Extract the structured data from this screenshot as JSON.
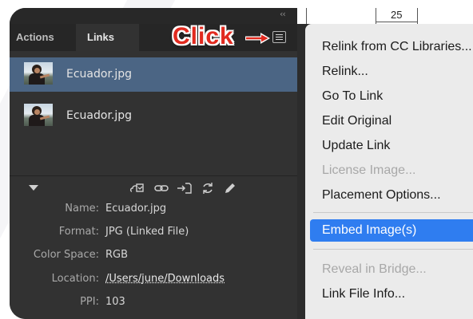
{
  "panel": {
    "tabs": [
      {
        "label": "Actions",
        "active": false
      },
      {
        "label": "Links",
        "active": true
      }
    ],
    "collapse_glyph": "‹‹",
    "links": [
      {
        "name": "Ecuador.jpg",
        "selected": true
      },
      {
        "name": "Ecuador.jpg",
        "selected": false
      }
    ],
    "toolbar_icons": [
      "relink-from-cc-icon",
      "chain-link-icon",
      "go-to-link-icon",
      "update-link-icon",
      "edit-original-icon"
    ],
    "info": [
      {
        "key": "Name:",
        "value": "Ecuador.jpg"
      },
      {
        "key": "Format:",
        "value": "JPG (Linked File)"
      },
      {
        "key": "Color Space:",
        "value": "RGB"
      },
      {
        "key": "Location:",
        "value": "/Users/june/Downloads"
      },
      {
        "key": "PPI:",
        "value": "103"
      }
    ]
  },
  "annotation": {
    "text": "Click",
    "color": "#e12a1f"
  },
  "document": {
    "page_number": "25"
  },
  "menu": {
    "items": [
      {
        "label": "Relink from CC Libraries...",
        "state": "normal"
      },
      {
        "label": "Relink...",
        "state": "normal"
      },
      {
        "label": "Go To Link",
        "state": "normal"
      },
      {
        "label": "Edit Original",
        "state": "normal"
      },
      {
        "label": "Update Link",
        "state": "normal"
      },
      {
        "label": "License Image...",
        "state": "disabled"
      },
      {
        "label": "Placement Options...",
        "state": "normal"
      },
      {
        "label": "Embed Image(s)",
        "state": "highlighted"
      },
      {
        "label": "Reveal in Bridge...",
        "state": "disabled"
      },
      {
        "label": "Link File Info...",
        "state": "normal"
      }
    ]
  },
  "colors": {
    "panel_bg": "#323232",
    "selection": "#4b6584",
    "menu_bg": "#ebebeb",
    "menu_highlight": "#2f7df0"
  }
}
